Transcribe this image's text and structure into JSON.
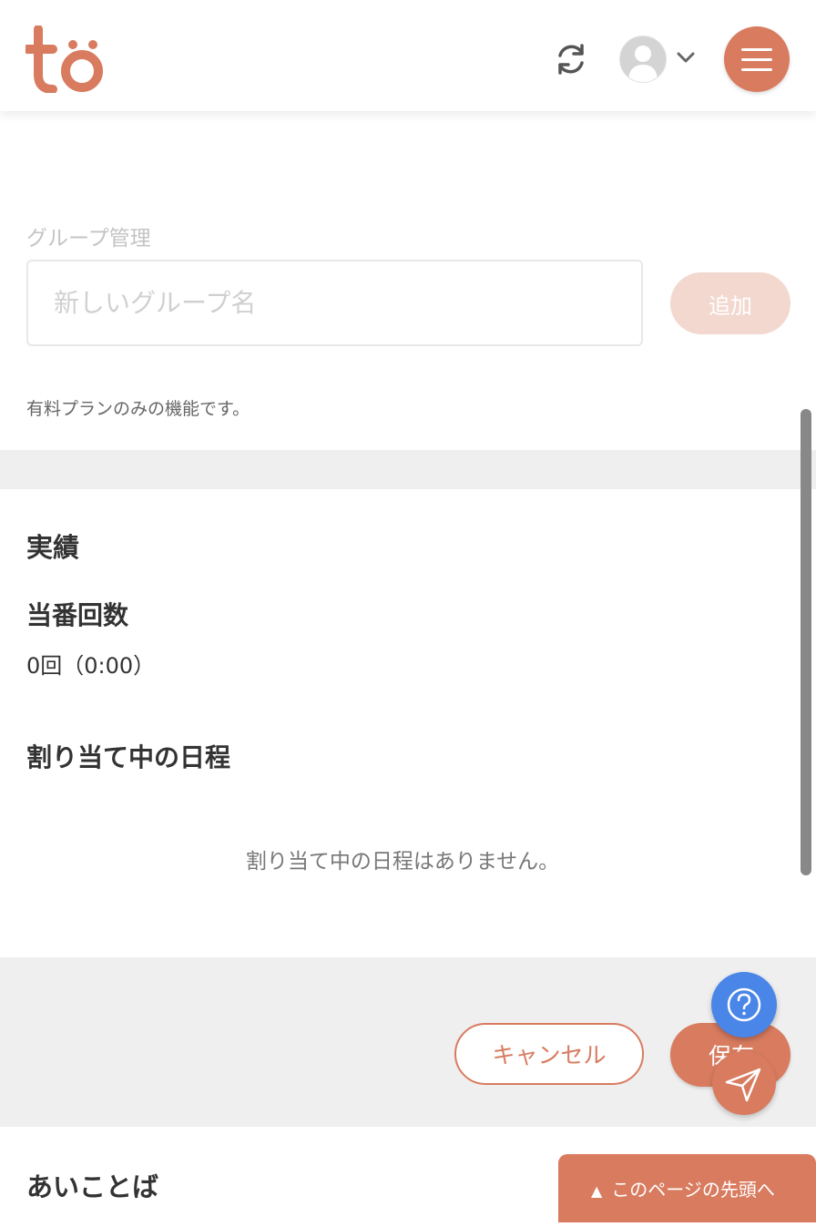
{
  "header": {
    "logo_text": "tö",
    "icons": {
      "sync": "sync-icon",
      "avatar": "user-avatar",
      "chevron": "chevron-down-icon",
      "menu": "hamburger-menu-icon"
    }
  },
  "group_management": {
    "label": "グループ管理",
    "input_placeholder": "新しいグループ名",
    "input_value": "",
    "add_button": "追加",
    "note": "有料プランのみの機能です。"
  },
  "results": {
    "title": "実績",
    "duty_count_label": "当番回数",
    "duty_count_value": "0回（0:00）",
    "assigned_schedule_label": "割り当て中の日程",
    "empty_message": "割り当て中の日程はありません。"
  },
  "actions": {
    "cancel": "キャンセル",
    "save": "保存"
  },
  "floating": {
    "help_icon": "question-icon",
    "send_icon": "paper-plane-icon"
  },
  "aikotoba": {
    "title": "あいことば"
  },
  "back_to_top": {
    "arrow": "▲",
    "label": "このページの先頭へ"
  },
  "colors": {
    "accent": "#d87b5f",
    "accent_light": "#f2d8cf",
    "help_blue": "#4a86e8",
    "band_gray": "#efefef"
  }
}
